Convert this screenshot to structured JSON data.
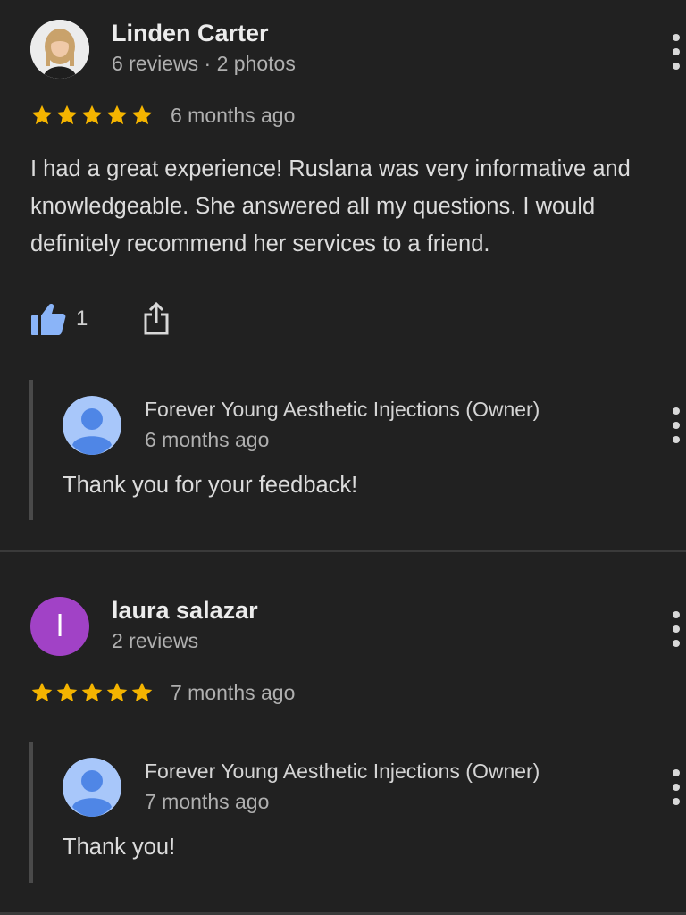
{
  "reviews": [
    {
      "author": "Linden Carter",
      "meta": "6 reviews · 2 photos",
      "rating": 5,
      "time": "6 months ago",
      "text": "I had a great experience! Ruslana was very informative and knowledgeable. She answered all my questions. I would definitely recommend her services to a friend.",
      "likes": "1",
      "avatar": "photo-avatar",
      "reply": {
        "author": "Forever Young Aesthetic Injections (Owner)",
        "time": "6 months ago",
        "text": "Thank you for your feedback!",
        "avatar": "default-person-avatar"
      }
    },
    {
      "author": "laura salazar",
      "meta": "2 reviews",
      "rating": 5,
      "time": "7 months ago",
      "avatar_letter": "l",
      "avatar_color": "#a142c6",
      "reply": {
        "author": "Forever Young Aesthetic Injections (Owner)",
        "time": "7 months ago",
        "text": "Thank you!",
        "avatar": "default-person-avatar"
      }
    }
  ],
  "colors": {
    "background": "#212121",
    "star": "#f4b400",
    "like_active": "#8ab4f8",
    "divider": "#3a3a3a"
  },
  "icons": [
    "star-icon",
    "thumbs-up-icon",
    "share-icon",
    "more-options-icon",
    "default-person-avatar"
  ]
}
